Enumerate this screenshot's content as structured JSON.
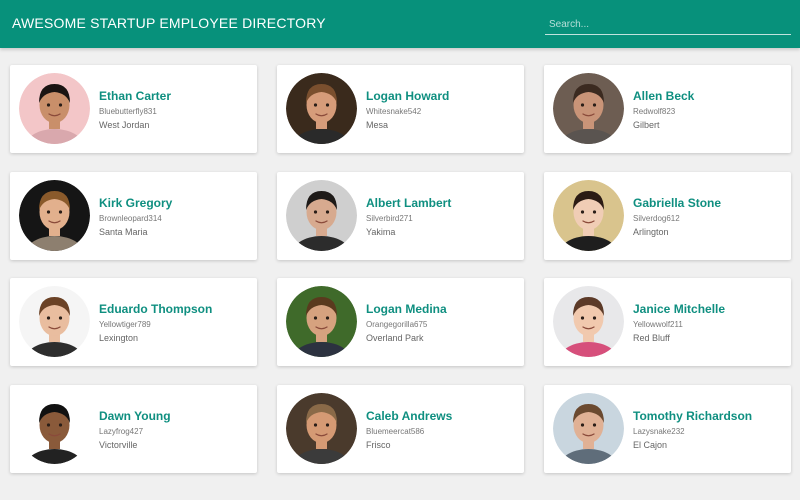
{
  "header": {
    "title": "AWESOME STARTUP EMPLOYEE DIRECTORY",
    "search_placeholder": "Search...",
    "search_value": ""
  },
  "colors": {
    "brand": "#07917b",
    "name_text": "#0f8f80"
  },
  "employees": [
    {
      "name": "Ethan Carter",
      "username": "Bluebutterfly831",
      "city": "West Jordan",
      "icon": "avatar-photo",
      "palette": {
        "bg": "#f3c6c8",
        "skin": "#c98f6a",
        "hair": "#1a1412",
        "shirt": "#d9a8ad"
      }
    },
    {
      "name": "Logan Howard",
      "username": "Whitesnake542",
      "city": "Mesa",
      "icon": "avatar-photo",
      "palette": {
        "bg": "#3a2a1c",
        "skin": "#d69c7a",
        "hair": "#7a4f2e",
        "shirt": "#2a2a2a"
      }
    },
    {
      "name": "Allen Beck",
      "username": "Redwolf823",
      "city": "Gilbert",
      "icon": "avatar-photo",
      "palette": {
        "bg": "#6d5d52",
        "skin": "#c99478",
        "hair": "#3b2a20",
        "shirt": "#5a5450"
      }
    },
    {
      "name": "Kirk Gregory",
      "username": "Brownleopard314",
      "city": "Santa Maria",
      "icon": "avatar-photo",
      "palette": {
        "bg": "#151515",
        "skin": "#e2b08d",
        "hair": "#8a5a2b",
        "shirt": "#8d7f6f"
      }
    },
    {
      "name": "Albert Lambert",
      "username": "Silverbird271",
      "city": "Yakima",
      "icon": "avatar-photo",
      "palette": {
        "bg": "#cfcfcf",
        "skin": "#d7aa8f",
        "hair": "#1e1a18",
        "shirt": "#2c2c2c"
      }
    },
    {
      "name": "Gabriella Stone",
      "username": "Silverdog612",
      "city": "Arlington",
      "icon": "avatar-photo",
      "palette": {
        "bg": "#d9c48d",
        "skin": "#f0cdb5",
        "hair": "#2b1b14",
        "shirt": "#1e1e1e"
      }
    },
    {
      "name": "Eduardo Thompson",
      "username": "Yellowtiger789",
      "city": "Lexington",
      "icon": "avatar-photo",
      "palette": {
        "bg": "#f5f5f5",
        "skin": "#e9bd9f",
        "hair": "#6b4226",
        "shirt": "#2d2d2d"
      }
    },
    {
      "name": "Logan Medina",
      "username": "Orangegorilla675",
      "city": "Overland Park",
      "icon": "avatar-photo",
      "palette": {
        "bg": "#3f6a2a",
        "skin": "#d6a27f",
        "hair": "#5a3a1e",
        "shirt": "#2c3240"
      }
    },
    {
      "name": "Janice Mitchelle",
      "username": "Yellowwolf211",
      "city": "Red Bluff",
      "icon": "avatar-photo",
      "palette": {
        "bg": "#e8e8ea",
        "skin": "#f1c9ae",
        "hair": "#5c3a28",
        "shirt": "#d64f7b"
      }
    },
    {
      "name": "Dawn Young",
      "username": "Lazyfrog427",
      "city": "Victorville",
      "icon": "avatar-photo",
      "palette": {
        "bg": "#ffffff",
        "skin": "#8a5a3a",
        "hair": "#111111",
        "shirt": "#222222"
      }
    },
    {
      "name": "Caleb Andrews",
      "username": "Bluemeercat586",
      "city": "Frisco",
      "icon": "avatar-photo",
      "palette": {
        "bg": "#4a3a2c",
        "skin": "#d59a74",
        "hair": "#8a6a48",
        "shirt": "#3b3b3b"
      }
    },
    {
      "name": "Tomothy Richardson",
      "username": "Lazysnake232",
      "city": "El Cajon",
      "icon": "avatar-photo",
      "palette": {
        "bg": "#c9d6df",
        "skin": "#e0b195",
        "hair": "#6b4a30",
        "shirt": "#5f6d7a"
      }
    }
  ]
}
